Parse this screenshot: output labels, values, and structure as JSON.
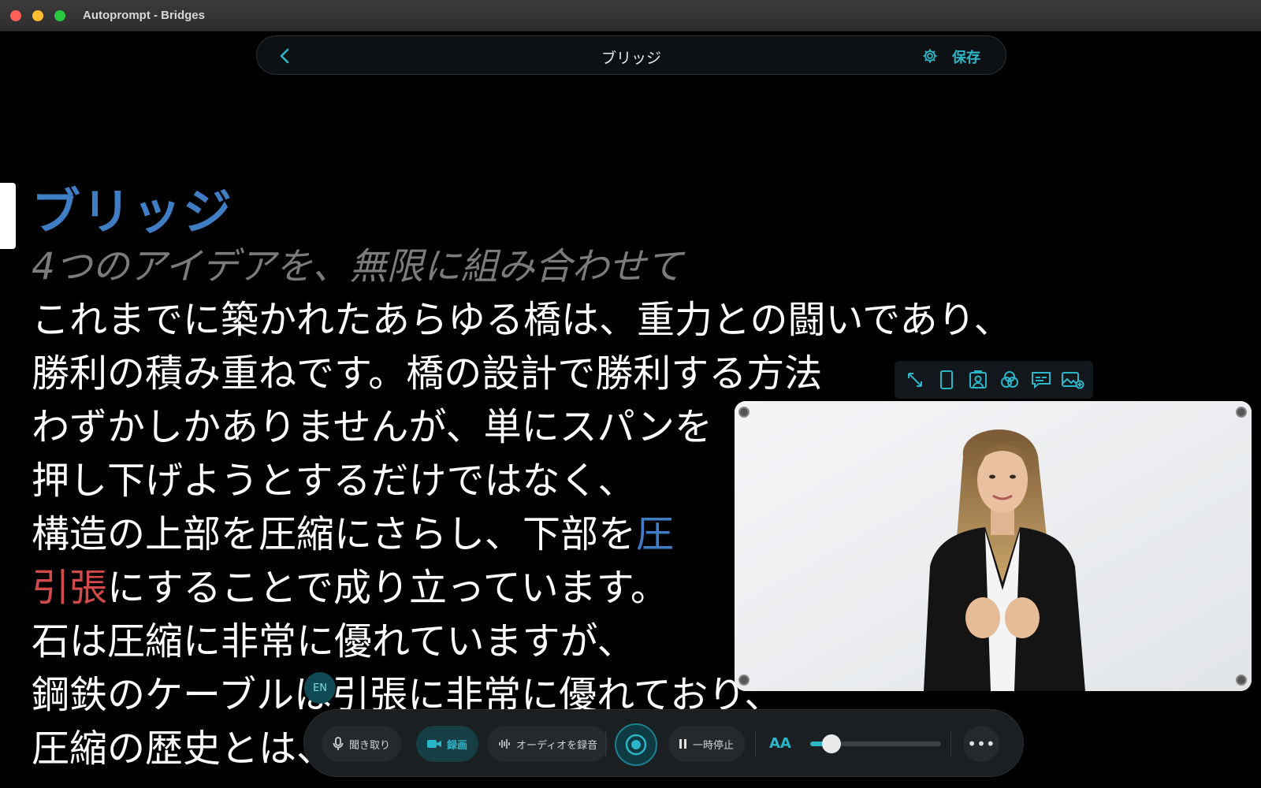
{
  "window": {
    "title": "Autoprompt - Bridges"
  },
  "topnav": {
    "title": "ブリッジ",
    "save_label": "保存"
  },
  "script": {
    "title": "ブリッジ",
    "subtitle": "4つのアイデアを、無限に組み合わせて",
    "lines": [
      {
        "text": "これまでに築かれたあらゆる橋は、重力との闘いであり、"
      },
      {
        "text": "勝利の積み重ねです。橋の設計で勝利する方法"
      },
      {
        "text": "わずかしかありませんが、単にスパンを"
      },
      {
        "text": "押し下げようとするだけではなく、"
      },
      {
        "pre": "構造の上部を圧縮にさらし、下部を",
        "blue": "圧"
      },
      {
        "red": "引張",
        "post": "にすることで成り立っています。"
      },
      {
        "text": "石は圧縮に非常に優れていますが、"
      },
      {
        "text": "鋼鉄のケーブルは引張に非常に優れており、"
      },
      {
        "text": "圧縮の歴史とは、それまでに存在した唯一の橋の形の場を"
      }
    ]
  },
  "language_badge": "EN",
  "video_tools": [
    "expand-icon",
    "portrait-icon",
    "person-frame-icon",
    "filter-icon",
    "captions-icon",
    "add-image-icon"
  ],
  "controls": {
    "listen_label": "聞き取り",
    "record_label": "録画",
    "audio_label": "オーディオを録音",
    "pause_label": "一時停止",
    "font_size_label": "AA",
    "font_size_level": 0.16
  },
  "colors": {
    "accent": "#2bb5c8",
    "title_blue": "#3f7ec4",
    "highlight_red": "#d24a4a"
  }
}
